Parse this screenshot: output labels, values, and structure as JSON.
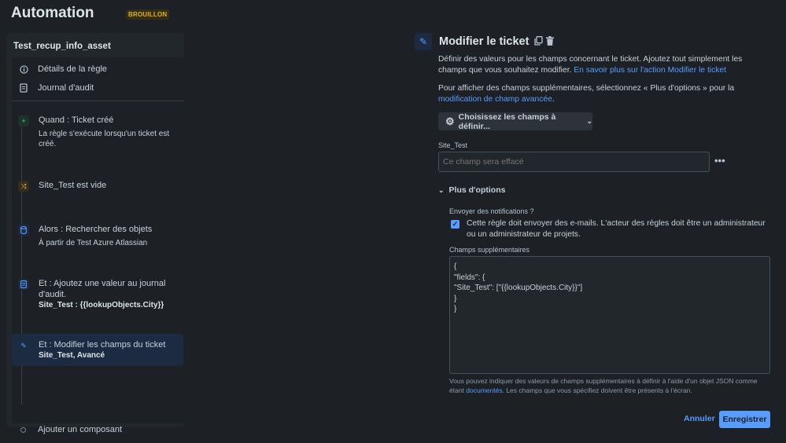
{
  "header": {
    "title": "Automation",
    "badge": "BROUILLON"
  },
  "sidebar": {
    "rule_name": "Test_recup_info_asset",
    "menu": [
      {
        "label": "Détails de la règle",
        "icon": "info-icon"
      },
      {
        "label": "Journal d'audit",
        "icon": "document-icon"
      }
    ],
    "steps": [
      {
        "title": "Quand : Ticket créé",
        "subtitle": "La règle s'exécute lorsqu'un ticket est créé.",
        "icon": "plus-icon",
        "color": "#4bce97"
      },
      {
        "title": "Site_Test est vide",
        "icon": "shuffle-icon",
        "color": "#f5cd47"
      },
      {
        "title": "Alors : Rechercher des objets",
        "subtitle": "À partir de Test Azure Atlassian",
        "icon": "database-icon",
        "color": "#579dff"
      },
      {
        "title": "Et : Ajoutez une valeur au journal d'audit.",
        "bold": "Site_Test : {{lookupObjects.City}}",
        "icon": "audit-log-icon",
        "color": "#579dff"
      },
      {
        "title": "Et : Modifier les champs du ticket",
        "bold": "Site_Test, Avancé",
        "icon": "pencil-icon",
        "color": "#579dff"
      }
    ],
    "add_component": "Ajouter un composant"
  },
  "panel": {
    "title": "Modifier le ticket",
    "desc1": "Définir des valeurs pour les champs concernant le ticket. Ajoutez tout simplement les champs que vous souhaitez modifier. ",
    "desc1_link": "En savoir plus sur l'action Modifier le ticket",
    "desc2": "Pour afficher des champs supplémentaires, sélectionnez « Plus d'options » pour la ",
    "desc2_link": "modification de champ avancée",
    "desc2_end": ".",
    "choose_fields": "Choisissez les champs à définir...",
    "field_label": "Site_Test",
    "field_placeholder": "Ce champ sera effacé",
    "more_options": "Plus d'options",
    "notif_label": "Envoyer des notifications ?",
    "notif_checkbox": "Cette règle doit envoyer des e-mails. L'acteur des règles doit être un administrateur ou un administrateur de projets.",
    "extra_label": "Champs supplémentaires",
    "json_value": "{\n\"fields\": {\n\"Site_Test\": [\"{{lookupObjects.City}}\"]\n}\n}",
    "help_text": "Vous pouvez indiquer des valeurs de champs supplémentaires à définir à l'aide d'un objet JSON comme étant ",
    "help_link": "documentés",
    "help_end": ". Les champs que vous spécifiez doivent être présents à l'écran.",
    "cancel": "Annuler",
    "save": "Enregistrer"
  }
}
